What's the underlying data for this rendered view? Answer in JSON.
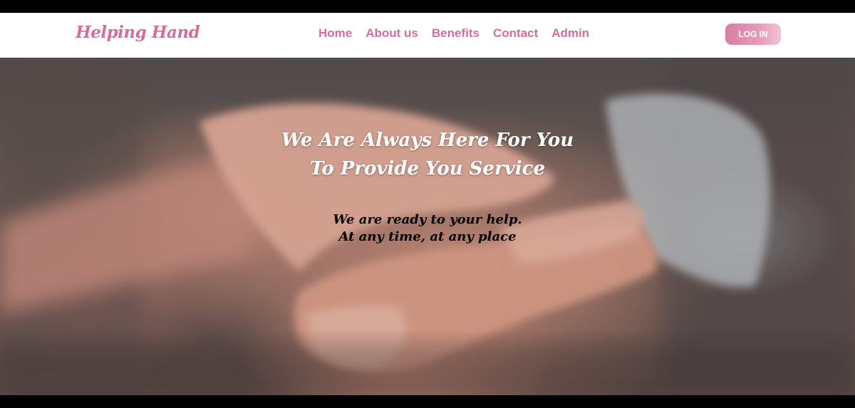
{
  "brand": {
    "name": "Helping Hand"
  },
  "nav": {
    "links": [
      {
        "label": "Home"
      },
      {
        "label": "About us"
      },
      {
        "label": "Benefits"
      },
      {
        "label": "Contact"
      },
      {
        "label": "Admin"
      }
    ],
    "login_label": "LOG IN"
  },
  "hero": {
    "title_line1": "We Are Always Here For You",
    "title_line2": "To Provide You Service",
    "subtitle_line1": "We are ready to your help.",
    "subtitle_line2": "At any time, at any place",
    "image_icon": "holding-hands-photo"
  },
  "colors": {
    "brand": "#d46e98",
    "accent_gradient_start": "#d97da3",
    "accent_gradient_end": "#f2c3d6"
  }
}
